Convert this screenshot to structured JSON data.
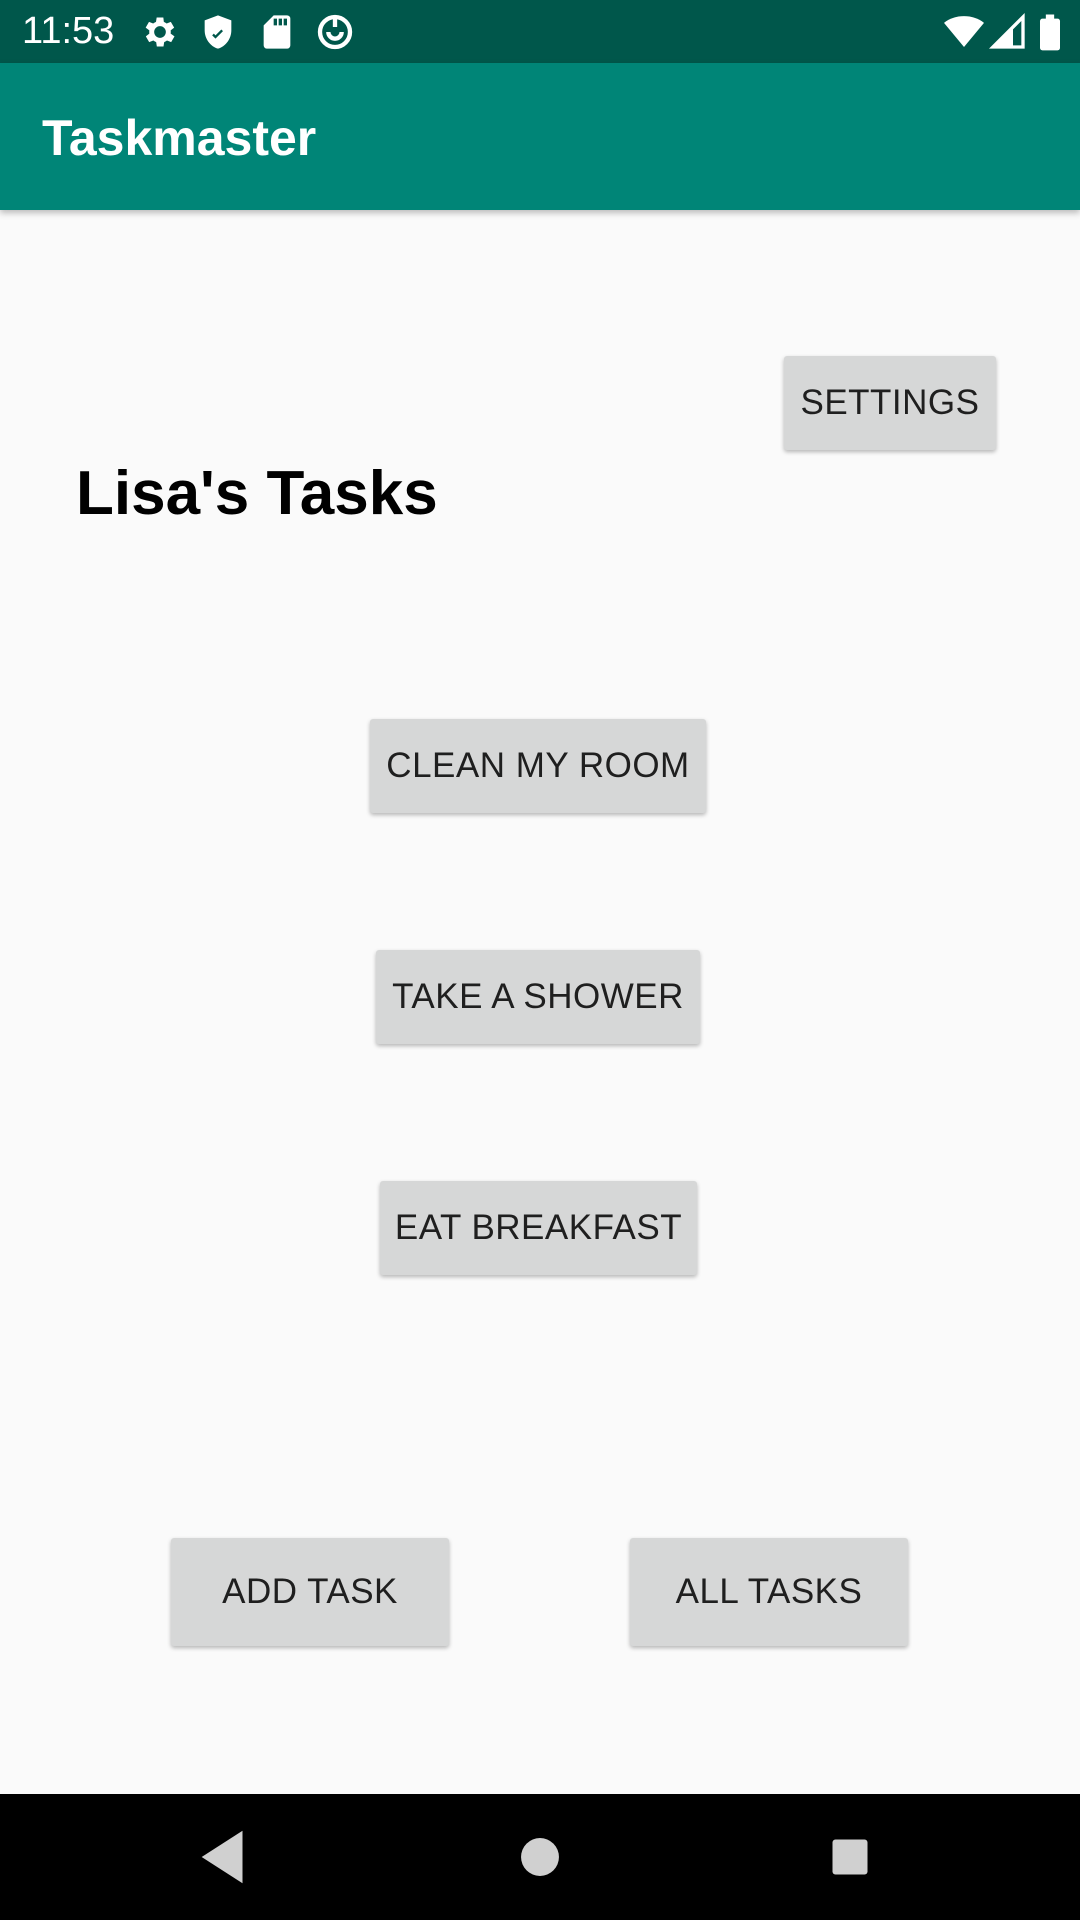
{
  "status_bar": {
    "time": "11:53",
    "icons": [
      "gear-icon",
      "shield-icon",
      "sd-card-icon",
      "data-saver-icon",
      "wifi-icon",
      "signal-icon",
      "battery-icon"
    ]
  },
  "app_bar": {
    "title": "Taskmaster",
    "color": "#008577",
    "status_color": "#00574b"
  },
  "main": {
    "heading": "Lisa's Tasks",
    "settings_label": "SETTINGS",
    "tasks": [
      {
        "label": "CLEAN MY ROOM"
      },
      {
        "label": "TAKE A SHOWER"
      },
      {
        "label": "EAT BREAKFAST"
      }
    ],
    "add_task_label": "ADD TASK",
    "all_tasks_label": "ALL TASKS"
  },
  "nav_bar": {
    "icons": [
      "back-icon",
      "home-icon",
      "recents-icon"
    ]
  }
}
